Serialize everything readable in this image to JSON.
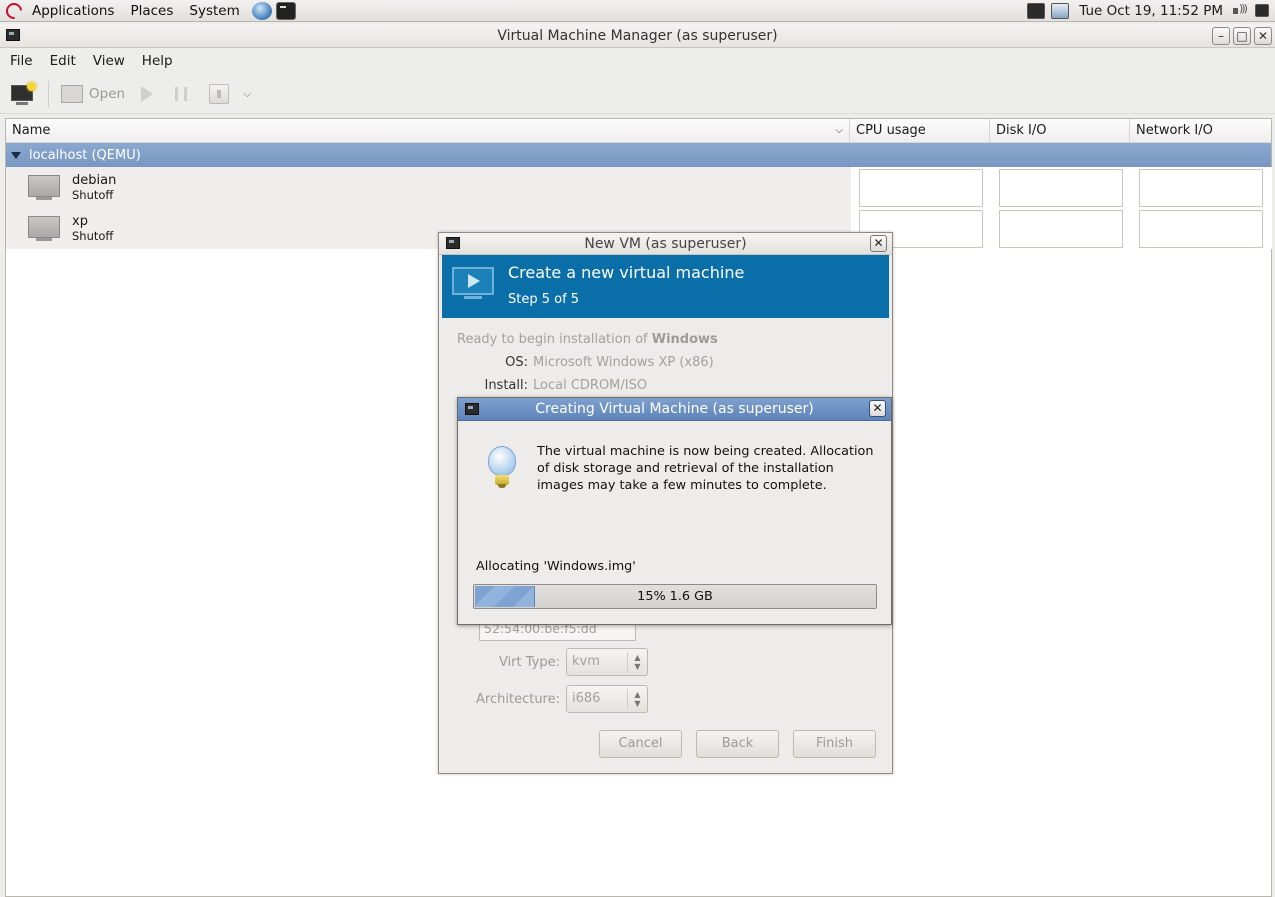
{
  "panel": {
    "menus": [
      "Applications",
      "Places",
      "System"
    ],
    "clock": "Tue Oct 19, 11:52 PM",
    "icons": [
      "debian-logo-icon",
      "globe-launcher-icon",
      "terminal-launcher-icon",
      "network-tray-icon",
      "display-tray-icon",
      "volume-icon",
      "monitor-tray-icon"
    ]
  },
  "main_window": {
    "title": "Virtual Machine Manager (as superuser)",
    "menubar": [
      "File",
      "Edit",
      "View",
      "Help"
    ],
    "toolbar": {
      "open_label": "Open"
    },
    "columns": [
      "Name",
      "CPU usage",
      "Disk I/O",
      "Network I/O"
    ],
    "group": "localhost (QEMU)",
    "vms": [
      {
        "name": "debian",
        "status": "Shutoff"
      },
      {
        "name": "xp",
        "status": "Shutoff"
      }
    ]
  },
  "new_vm_dialog": {
    "title": "New VM (as superuser)",
    "banner_title": "Create a new virtual machine",
    "banner_step": "Step 5 of 5",
    "ready_prefix": "Ready to begin installation of ",
    "ready_name": "Windows",
    "os_label": "OS:",
    "os_value": "Microsoft Windows XP (x86)",
    "install_label": "Install:",
    "install_value": "Local CDROM/ISO",
    "mac_value": "52:54:00:be:f5:dd",
    "virt_type_label": "Virt Type:",
    "virt_type_value": "kvm",
    "arch_label": "Architecture:",
    "arch_value": "i686",
    "buttons": {
      "cancel": "Cancel",
      "back": "Back",
      "finish": "Finish"
    }
  },
  "creating_dialog": {
    "title": "Creating Virtual Machine (as superuser)",
    "message": "The virtual machine is now being created. Allocation of disk storage and retrieval of the installation images may take a few minutes to complete.",
    "allocating": "Allocating 'Windows.img'",
    "progress_fraction": 0.15,
    "progress_text": "15% 1.6 GB"
  },
  "colors": {
    "selection_blue": "#7897c1",
    "banner_blue": "#0a6ea8",
    "dialog_title_blue": "#6a8dc2"
  }
}
